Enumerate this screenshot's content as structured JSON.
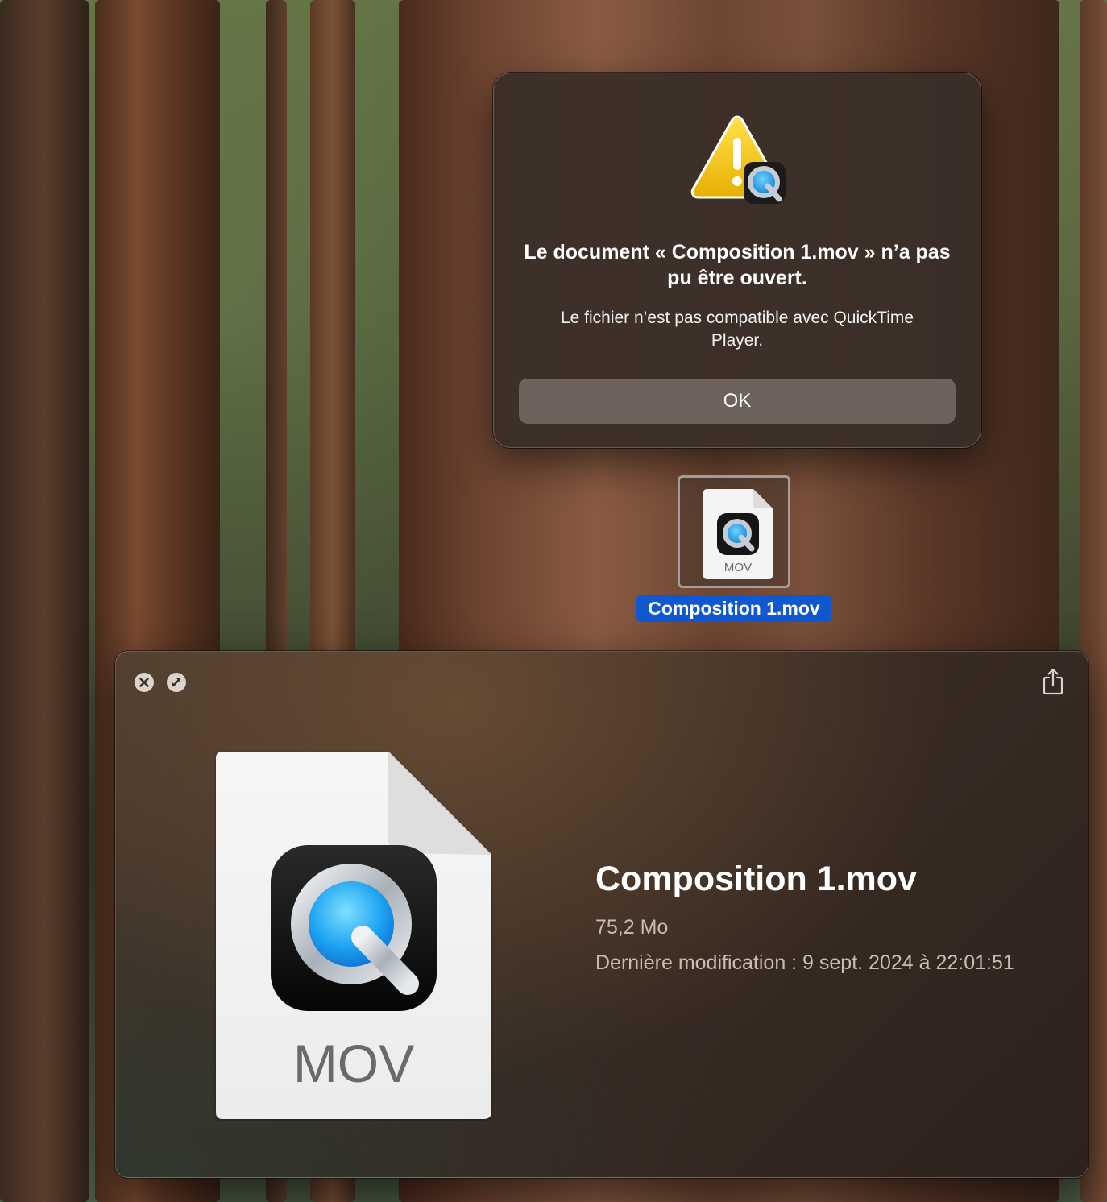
{
  "alert": {
    "title": "Le document « Composition 1.mov » n’a pas pu être ouvert.",
    "message": "Le fichier n’est pas compatible avec QuickTime Player.",
    "ok_label": "OK",
    "icon": "caution-quicktime-icon"
  },
  "desktop_icon": {
    "filename": "Composition 1.mov",
    "file_type_badge": "MOV",
    "icon": "quicktime-document-icon"
  },
  "quicklook": {
    "close_icon": "close-icon",
    "fullscreen_icon": "fullscreen-icon",
    "share_icon": "share-icon",
    "file_type_badge": "MOV",
    "filename": "Composition 1.mov",
    "size": "75,2 Mo",
    "modified": "Dernière modification : 9 sept. 2024 à 22:01:51"
  },
  "colors": {
    "selection_blue": "#1058d0",
    "alert_background": "#3a2e28",
    "button_background": "#6e625d",
    "quicktime_blue": "#1fa4f2",
    "caution_yellow": "#f3c300"
  }
}
